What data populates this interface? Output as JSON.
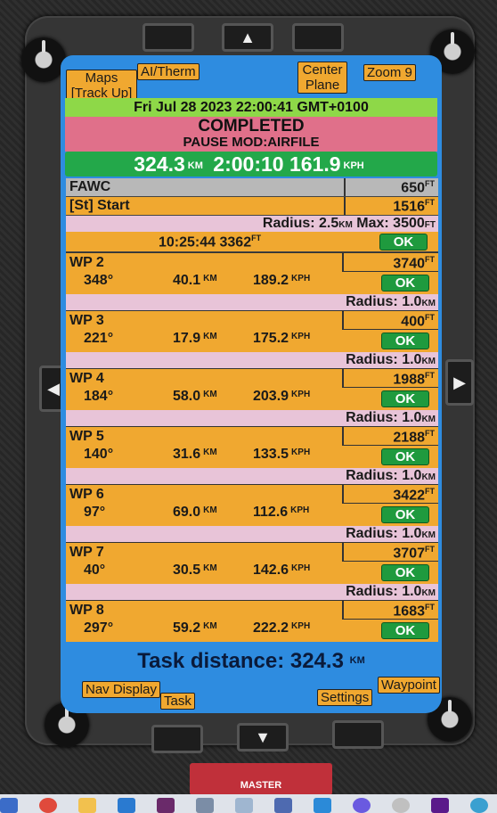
{
  "hw": {
    "up_arrow": "▲",
    "down_arrow": "▼",
    "left_arrow": "◀",
    "right_arrow": "▶"
  },
  "softkeys": {
    "maps": "Maps",
    "track_up": "[Track Up]",
    "ai_therm": "AI/Therm",
    "center": "Center",
    "plane": "Plane",
    "zoom": "Zoom 9",
    "nav_display": "Nav Display",
    "task": "Task",
    "settings": "Settings",
    "waypoint": "Waypoint"
  },
  "datetime": "Fri Jul 28 2023 22:00:41 GMT+0100",
  "status": {
    "line1": "COMPLETED",
    "line2": "PAUSE MOD:AIRFILE"
  },
  "summary": {
    "distance": "324.3",
    "dist_unit": "KM",
    "time": "2:00:10",
    "speed": "161.9",
    "speed_unit": "KPH"
  },
  "start": {
    "name": "FAWC",
    "name_alt": "650",
    "alt_unit": "FT",
    "label": "[St] Start",
    "start_alt": "1516",
    "radius_label": "Radius: 2.5",
    "radius_unit": "KM",
    "max_label": "Max: 3500",
    "max_unit": "FT",
    "time": "10:25:44",
    "time_alt": "3362",
    "time_alt_unit": "FT",
    "ok": "OK"
  },
  "waypoints": [
    {
      "name": "WP 2",
      "bearing": "348°",
      "dist": "40.1",
      "speed": "189.2",
      "alt": "3740",
      "ok": "OK",
      "radius": "Radius: 1.0"
    },
    {
      "name": "WP 3",
      "bearing": "221°",
      "dist": "17.9",
      "speed": "175.2",
      "alt": "400",
      "ok": "OK",
      "radius": "Radius: 1.0"
    },
    {
      "name": "WP 4",
      "bearing": "184°",
      "dist": "58.0",
      "speed": "203.9",
      "alt": "1988",
      "ok": "OK",
      "radius": "Radius: 1.0"
    },
    {
      "name": "WP 5",
      "bearing": "140°",
      "dist": "31.6",
      "speed": "133.5",
      "alt": "2188",
      "ok": "OK",
      "radius": "Radius: 1.0"
    },
    {
      "name": "WP 6",
      "bearing": "97°",
      "dist": "69.0",
      "speed": "112.6",
      "alt": "3422",
      "ok": "OK",
      "radius": "Radius: 1.0"
    },
    {
      "name": "WP 7",
      "bearing": "40°",
      "dist": "30.5",
      "speed": "142.6",
      "alt": "3707",
      "ok": "OK",
      "radius": "Radius: 1.0"
    },
    {
      "name": "WP 8",
      "bearing": "297°",
      "dist": "59.2",
      "speed": "222.2",
      "alt": "1683",
      "ok": "OK"
    }
  ],
  "units": {
    "km": "KM",
    "kph": "KPH",
    "ft": "FT"
  },
  "task_distance": {
    "label": "Task distance: 324.3",
    "unit": "KM"
  },
  "master": "MASTER"
}
